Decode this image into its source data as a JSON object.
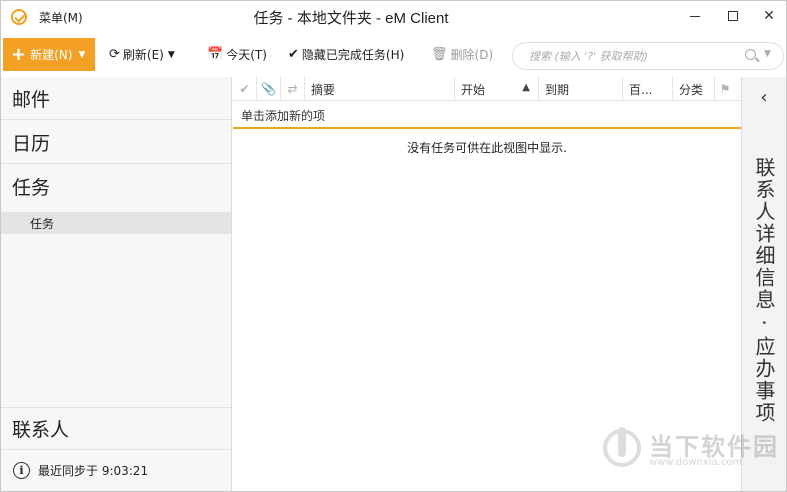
{
  "titlebar": {
    "menu_label": "菜单(M)",
    "title": "任务 - 本地文件夹 - eM Client"
  },
  "toolbar": {
    "new_label": "新建(N)",
    "refresh_label": "刷新(E)",
    "today_label": "今天(T)",
    "hide_completed_label": "隐藏已完成任务(H)",
    "delete_label": "删除(D)",
    "search_placeholder": "搜索 (输入 '?' 获取帮助)"
  },
  "nav": {
    "mail": "邮件",
    "calendar": "日历",
    "tasks": "任务",
    "tasks_sub": "任务",
    "contacts": "联系人",
    "sync_status": "最近同步于 9:03:21"
  },
  "task_list": {
    "columns": [
      "摘要",
      "开始",
      "到期",
      "百...",
      "分类"
    ],
    "add_new_label": "单击添加新的项",
    "empty_message": "没有任务可供在此视图中显示."
  },
  "right_panel": {
    "title": "联系人详细信息 · 应办事项"
  },
  "watermark": {
    "text": "当下软件园",
    "url": "www.downxia.com"
  },
  "colors": {
    "accent": "#f3a024"
  }
}
